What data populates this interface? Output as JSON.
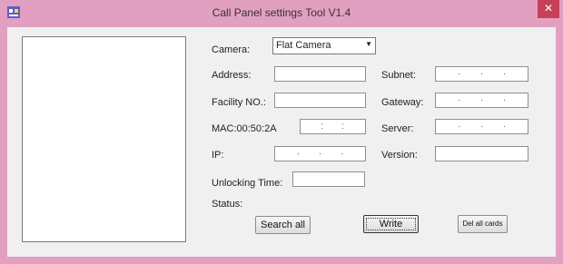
{
  "window": {
    "title": "Call Panel settings Tool V1.4",
    "close_symbol": "✕"
  },
  "form": {
    "camera_label": "Camera:",
    "camera_value": "Flat Camera",
    "address_label": "Address:",
    "facility_label": "Facility NO.:",
    "mac_label": "MAC:00:50:2A",
    "ip_label": "IP:",
    "subnet_label": "Subnet:",
    "gateway_label": "Gateway:",
    "server_label": "Server:",
    "version_label": "Version:",
    "unlocking_label": "Unlocking  Time:",
    "status_label": "Status:"
  },
  "buttons": {
    "search_all": "Search all",
    "write": "Write",
    "del_all_cards": "Del all cards"
  },
  "colors": {
    "titlebar": "#e2a0c0",
    "close": "#c7405a"
  }
}
